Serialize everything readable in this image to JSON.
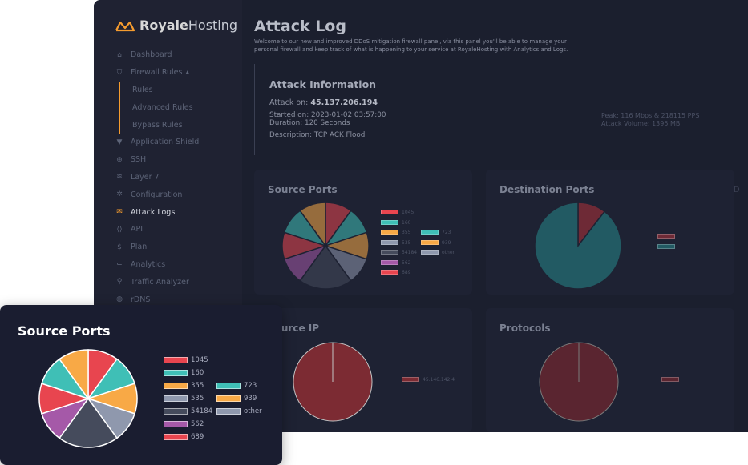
{
  "brand": {
    "name_bold": "Royale",
    "name_light": "Hosting",
    "accent": "#f59c2f"
  },
  "sidebar": {
    "items": [
      {
        "label": "Dashboard",
        "icon": "home-icon"
      },
      {
        "label": "Firewall Rules",
        "icon": "shield-icon",
        "expanded": true
      },
      {
        "label": "Application Shield",
        "icon": "filter-icon"
      },
      {
        "label": "SSH",
        "icon": "crosshair-icon"
      },
      {
        "label": "Layer 7",
        "icon": "layers-icon"
      },
      {
        "label": "Configuration",
        "icon": "gear-icon"
      },
      {
        "label": "Attack Logs",
        "icon": "log-icon",
        "active": true
      },
      {
        "label": "API",
        "icon": "code-icon"
      },
      {
        "label": "Plan",
        "icon": "dollar-icon"
      },
      {
        "label": "Analytics",
        "icon": "chart-icon"
      },
      {
        "label": "Traffic Analyzer",
        "icon": "search-icon"
      },
      {
        "label": "rDNS",
        "icon": "globe-icon"
      }
    ],
    "firewall_sub": [
      "Rules",
      "Advanced Rules",
      "Bypass Rules"
    ],
    "firewall_caret": "▲"
  },
  "page": {
    "title": "Attack Log",
    "subtitle": "Welcome to our new and improved DDoS mitigation firewall panel, via this panel you'll be able to manage your personal firewall and keep track of what is happening to your service at RoyaleHosting with Analytics and Logs."
  },
  "attack": {
    "heading": "Attack Information",
    "on_label": "Attack on:",
    "ip": "45.137.206.194",
    "started": "Started on: 2023-01-02 03:57:00",
    "duration": "Duration: 120 Seconds",
    "description": "Description: TCP ACK Flood",
    "peak": "Peak: 116 Mbps & 218115 PPS",
    "volume": "Attack Volume: 1395 MB"
  },
  "cards": {
    "source_ports": "Source Ports",
    "destination_ports": "Destination Ports",
    "source_ip": "Source IP",
    "protocols": "Protocols",
    "cut_label": "D"
  },
  "chart_data": [
    {
      "type": "pie",
      "title": "Source Ports",
      "slices": [
        {
          "label": "1045",
          "value": 9,
          "color": "#e8454f"
        },
        {
          "label": "160",
          "value": 9,
          "color": "#3fbfb6"
        },
        {
          "label": "355",
          "value": 9,
          "color": "#f8a946"
        },
        {
          "label": "535",
          "value": 9,
          "color": "#8f98ad"
        },
        {
          "label": "54184",
          "value": 18,
          "color": "#454b5c"
        },
        {
          "label": "562",
          "value": 9,
          "color": "#a559a8"
        },
        {
          "label": "689",
          "value": 9,
          "color": "#e8454f"
        },
        {
          "label": "723",
          "value": 9,
          "color": "#3fbfb6"
        },
        {
          "label": "939",
          "value": 9,
          "color": "#f8a946"
        },
        {
          "label": "other",
          "value": 0,
          "color": "#8f98ad",
          "hidden": true
        }
      ]
    },
    {
      "type": "pie",
      "title": "Destination Ports",
      "slices": [
        {
          "label": "",
          "value": 10.5,
          "color": "#6e2a36"
        },
        {
          "label": "",
          "value": 89.5,
          "color": "#225a63"
        }
      ]
    },
    {
      "type": "pie",
      "title": "Source IP",
      "slices": [
        {
          "label": "45.146.142.4",
          "value": 100,
          "color": "#7c2b33"
        }
      ]
    },
    {
      "type": "pie",
      "title": "Protocols",
      "slices": [
        {
          "label": "",
          "value": 100,
          "color": "#5a2530"
        }
      ]
    }
  ]
}
